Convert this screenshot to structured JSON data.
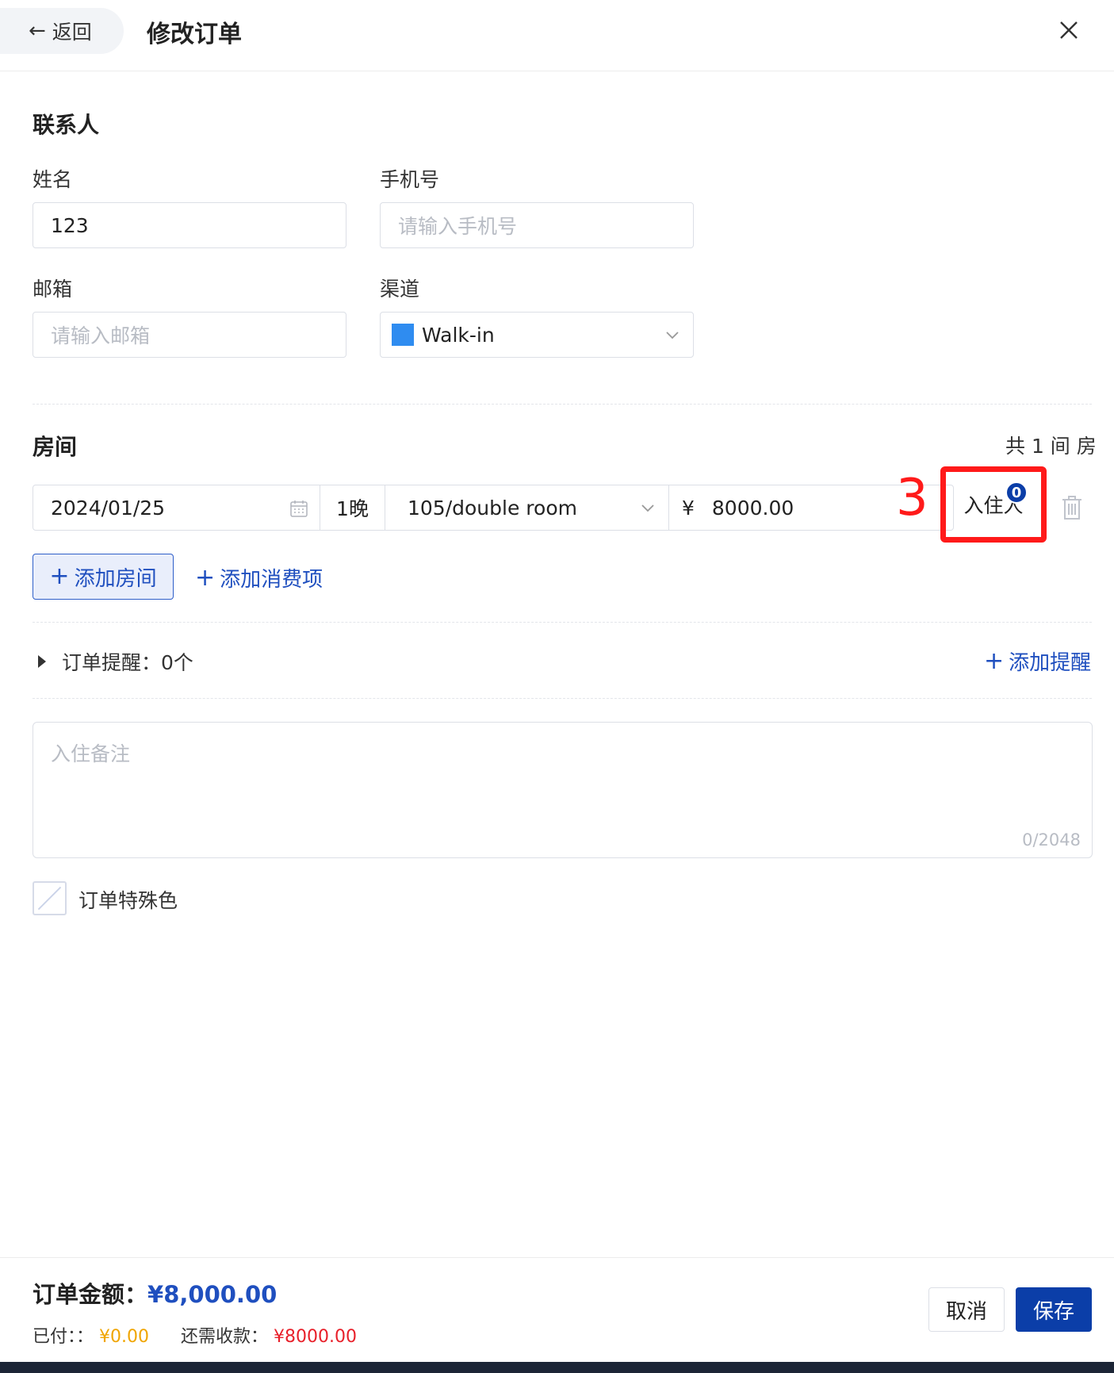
{
  "header": {
    "back_label": "返回",
    "title": "修改订单"
  },
  "contact": {
    "section_title": "联系人",
    "name_label": "姓名",
    "name_value": "123",
    "phone_label": "手机号",
    "phone_placeholder": "请输入手机号",
    "email_label": "邮箱",
    "email_placeholder": "请输入邮箱",
    "channel_label": "渠道",
    "channel_value": "Walk-in",
    "channel_color": "#2f8cf0"
  },
  "rooms": {
    "section_title": "房间",
    "count_text": "共 1 间 房",
    "row": {
      "date": "2024/01/25",
      "nights": "1晚",
      "room": "105/double room",
      "currency": "¥",
      "price": "8000.00",
      "guest_label": "入住人",
      "guest_count": "0"
    },
    "step_annotation": "3",
    "add_room_label": "添加房间",
    "add_expense_label": "添加消费项"
  },
  "reminder": {
    "label": "订单提醒：0个",
    "add_label": "添加提醒"
  },
  "notes": {
    "placeholder": "入住备注",
    "counter": "0/2048"
  },
  "special_color_label": "订单特殊色",
  "footer": {
    "total_label": "订单金额：",
    "total_value": "¥8,000.00",
    "paid_label": "已付：：",
    "paid_value": "¥0.00",
    "due_label": "还需收款：",
    "due_value": "¥8000.00",
    "paid_color": "#f0a500",
    "due_color": "#e8202a",
    "cancel_label": "取消",
    "save_label": "保存"
  }
}
